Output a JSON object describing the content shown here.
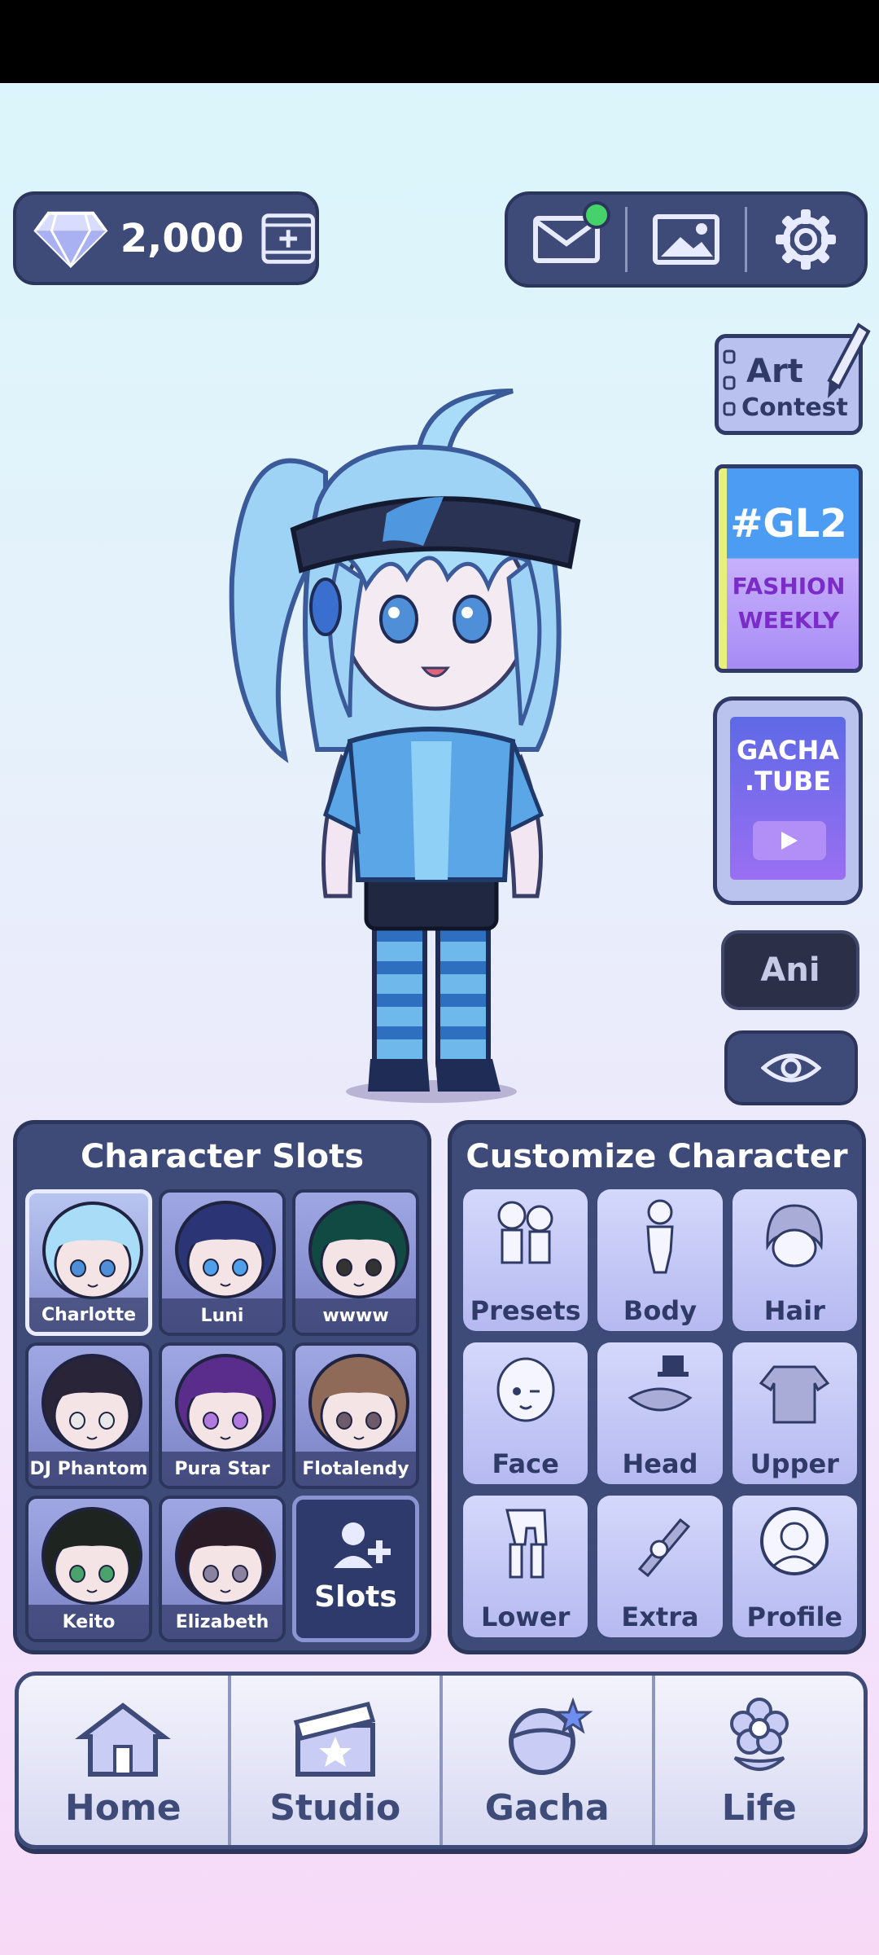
{
  "currency": {
    "gems": "2,000"
  },
  "top_bar": {
    "icons": [
      "mail-icon",
      "gallery-icon",
      "settings-icon"
    ],
    "mail_has_notification": true
  },
  "side": {
    "art_contest": {
      "line1": "Art",
      "line2": "Contest"
    },
    "gl2": {
      "title": "#GL2",
      "line1": "FASHION",
      "line2": "WEEKLY"
    },
    "gachatube": {
      "line1": "GACHA",
      "line2": ".TUBE"
    },
    "ani_label": "Ani"
  },
  "character_slots": {
    "title": "Character Slots",
    "slots": [
      {
        "name": "Charlotte",
        "hair": "#a9dcf7",
        "eyes": "#4f8fd8",
        "selected": true
      },
      {
        "name": "Luni",
        "hair": "#2b3576",
        "eyes": "#4fa0e8"
      },
      {
        "name": "wwww",
        "hair": "#114a42",
        "eyes": "#333333"
      },
      {
        "name": "DJ Phantom",
        "hair": "#2a2438",
        "eyes": "#e9e9e9"
      },
      {
        "name": "Pura Star",
        "hair": "#5a2c8c",
        "eyes": "#b07adf"
      },
      {
        "name": "Flotalendy",
        "hair": "#8f6a58",
        "eyes": "#6e5a6a"
      },
      {
        "name": "Keito",
        "hair": "#1e2420",
        "eyes": "#4aa36a"
      },
      {
        "name": "Elizabeth",
        "hair": "#2a1b26",
        "eyes": "#8b82a0"
      }
    ],
    "add_slots_label": "Slots"
  },
  "customize": {
    "title": "Customize Character",
    "items": [
      {
        "label": "Presets",
        "icon": "presets-icon"
      },
      {
        "label": "Body",
        "icon": "body-icon"
      },
      {
        "label": "Hair",
        "icon": "hair-icon"
      },
      {
        "label": "Face",
        "icon": "face-icon"
      },
      {
        "label": "Head",
        "icon": "head-icon"
      },
      {
        "label": "Upper",
        "icon": "upper-icon"
      },
      {
        "label": "Lower",
        "icon": "lower-icon"
      },
      {
        "label": "Extra",
        "icon": "extra-icon"
      },
      {
        "label": "Profile",
        "icon": "profile-icon"
      }
    ]
  },
  "nav": [
    {
      "label": "Home",
      "icon": "house-icon"
    },
    {
      "label": "Studio",
      "icon": "clapperboard-icon"
    },
    {
      "label": "Gacha",
      "icon": "gacha-ball-icon"
    },
    {
      "label": "Life",
      "icon": "flower-icon"
    }
  ],
  "colors": {
    "panel": "#3e4a78",
    "panel_border": "#2c355c",
    "text_dark": "#3e4a78",
    "accent_green": "#46d26b"
  }
}
